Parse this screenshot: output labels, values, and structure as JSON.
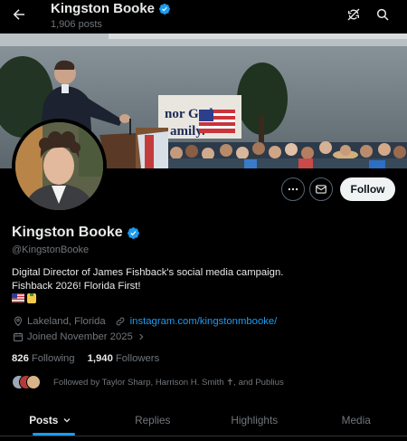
{
  "header": {
    "name": "Kingston Booke",
    "post_count": "1,906 posts",
    "back_icon": "arrow-left-icon",
    "refresh_icon": "refresh-slash-icon",
    "search_icon": "search-icon"
  },
  "profile": {
    "name": "Kingston Booke",
    "handle": "@KingstonBooke",
    "verified": true,
    "bio_line1": "Digital Director of James Fishback's social media campaign.",
    "bio_line2": "Fishback 2026! Florida First!",
    "flags": [
      "🇺🇸",
      "🍍"
    ],
    "location": "Lakeland, Florida",
    "website": "instagram.com/kingstonmbooke/",
    "joined": "Joined November 2025",
    "following_count": "826",
    "following_label": "Following",
    "followers_count": "1,940",
    "followers_label": "Followers",
    "followed_by": "Followed by Taylor Sharp, Harrison H. Smith ✝, and Publius"
  },
  "banner": {
    "sign_line1": "nor God.",
    "sign_line2": "amily."
  },
  "actions": {
    "more_icon": "more-horizontal-icon",
    "message_icon": "envelope-icon",
    "follow_label": "Follow"
  },
  "tabs": [
    {
      "label": "Posts",
      "active": true
    },
    {
      "label": "Replies",
      "active": false
    },
    {
      "label": "Highlights",
      "active": false
    },
    {
      "label": "Media",
      "active": false
    }
  ],
  "colors": {
    "accent": "#1d9bf0",
    "background": "#000000",
    "text_primary": "#e7e9ea",
    "text_secondary": "#71767b"
  }
}
